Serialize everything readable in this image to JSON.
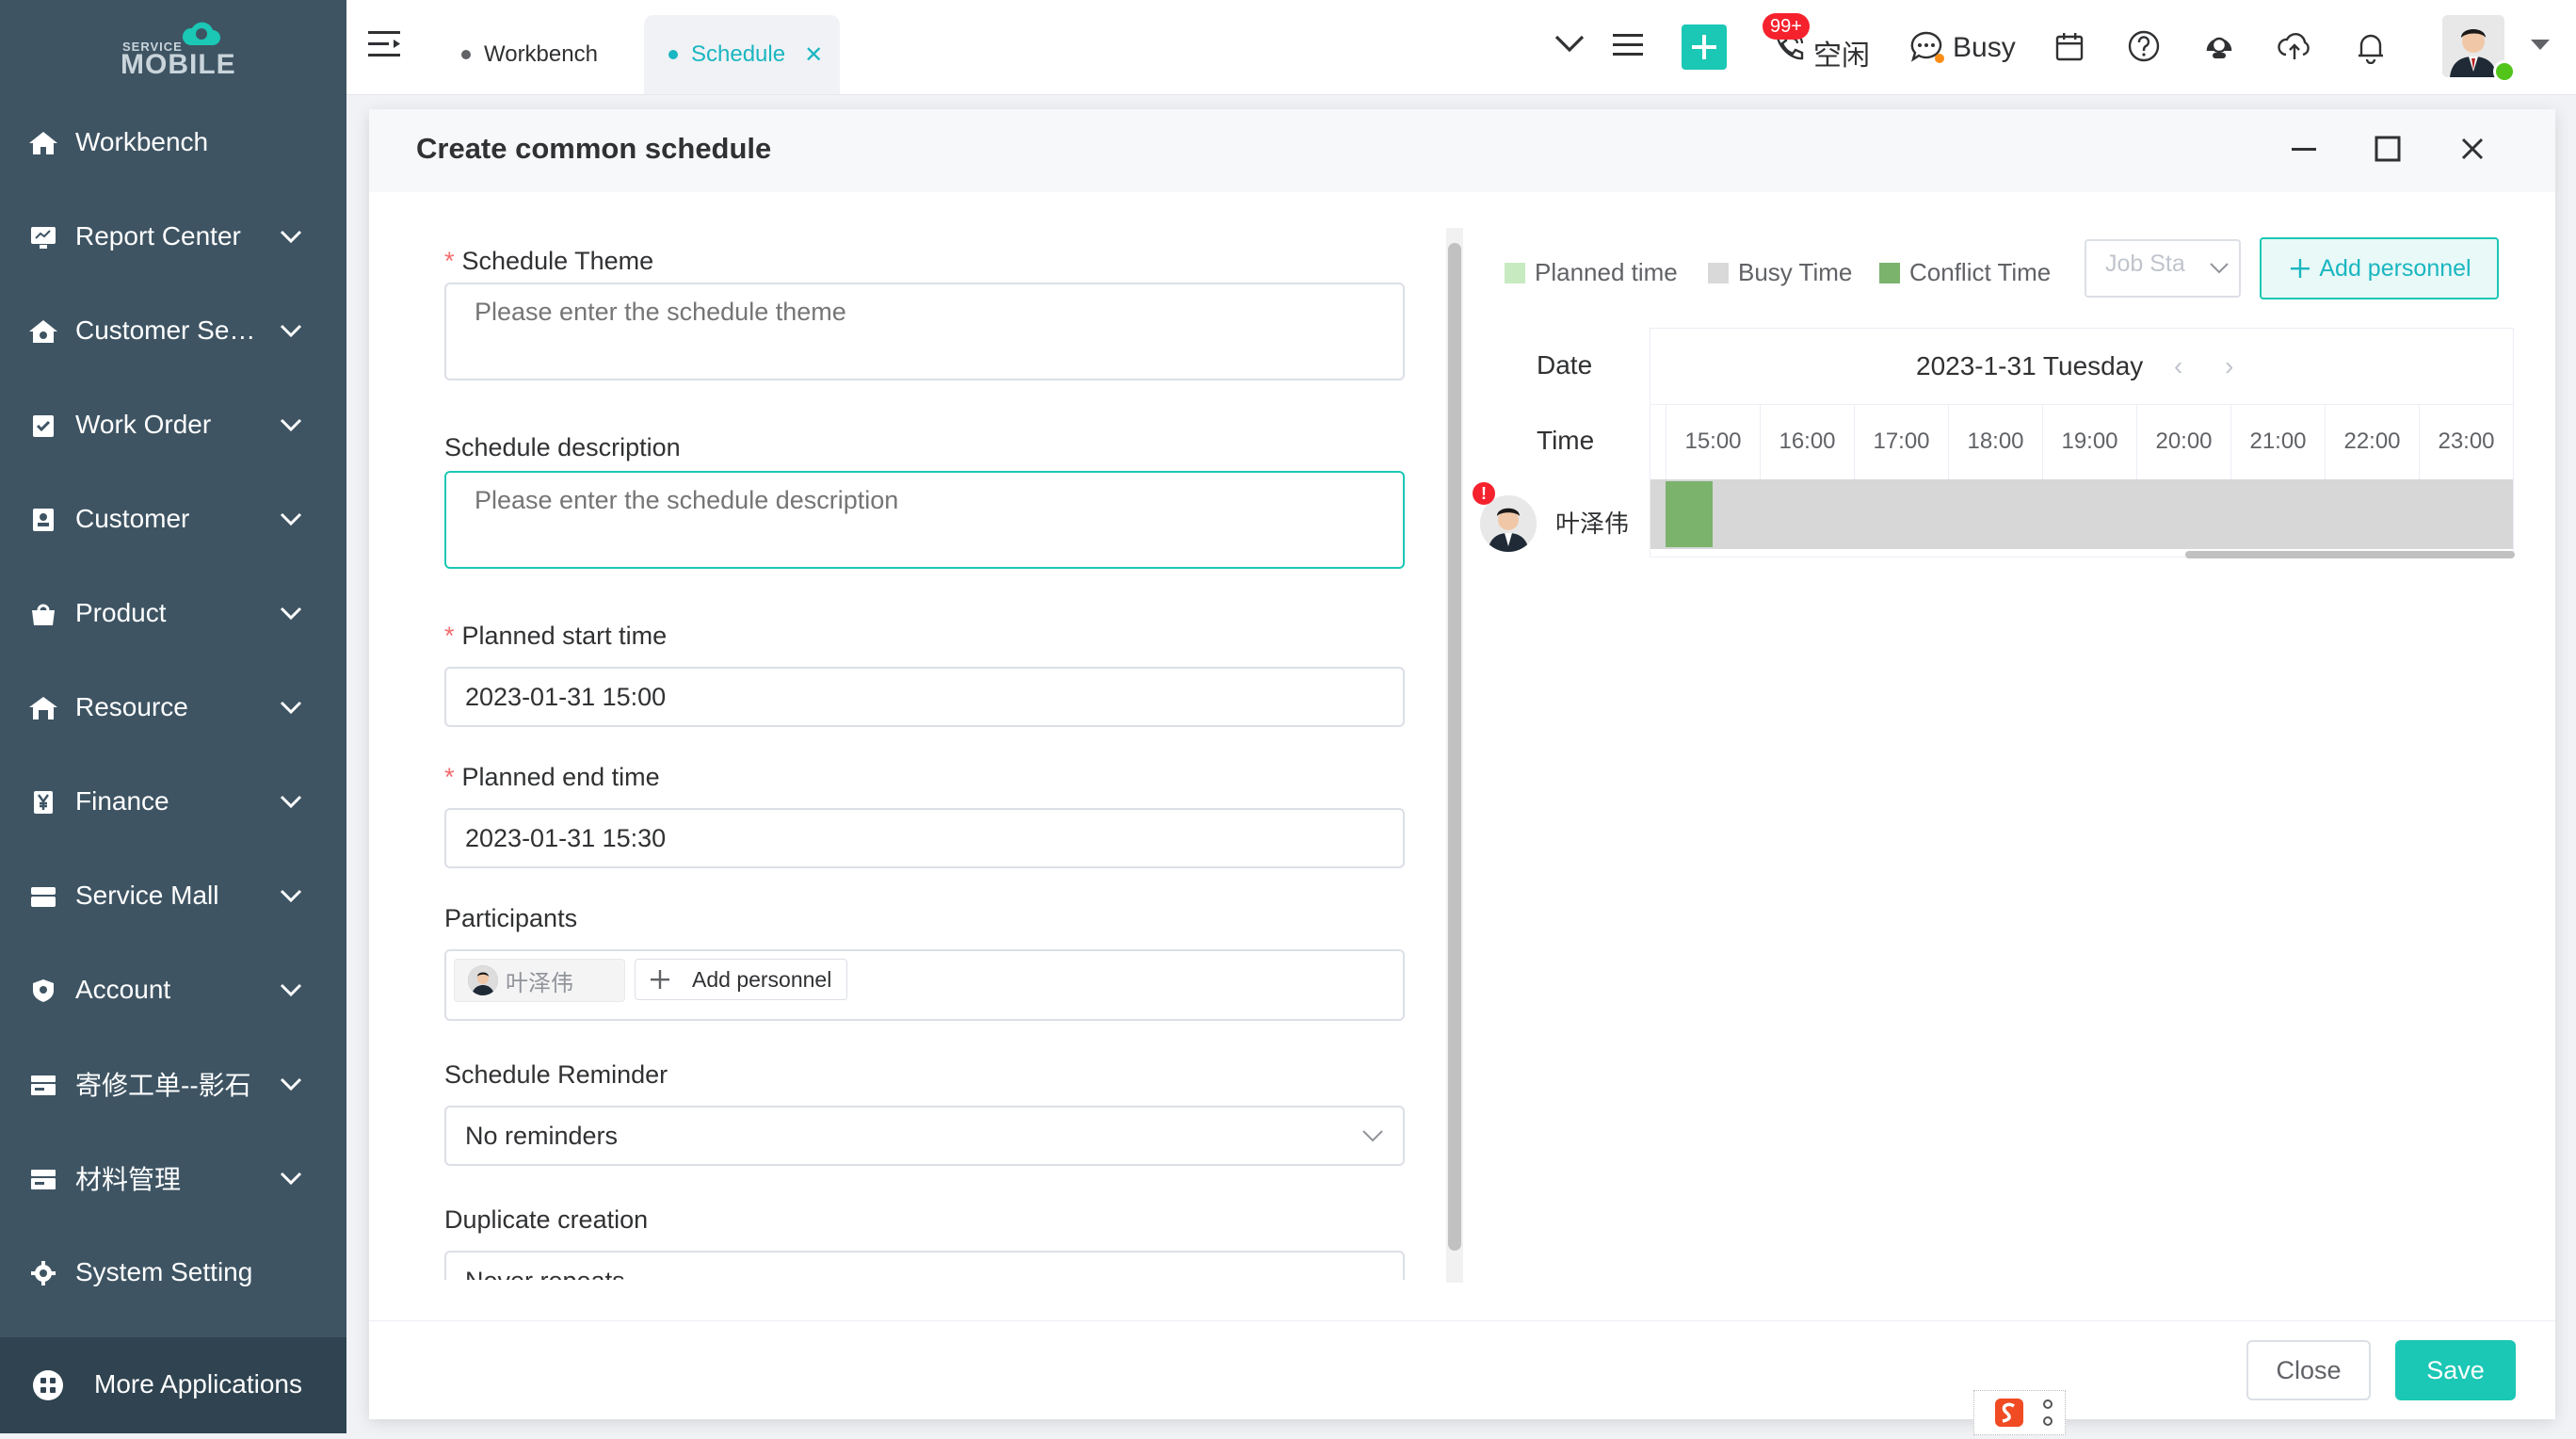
{
  "brand": {
    "line1": "SERVICE",
    "line2": "MOBILE"
  },
  "sidebar": {
    "items": [
      {
        "label": "Workbench"
      },
      {
        "label": "Report Center"
      },
      {
        "label": "Customer Se…"
      },
      {
        "label": "Work Order"
      },
      {
        "label": "Customer"
      },
      {
        "label": "Product"
      },
      {
        "label": "Resource"
      },
      {
        "label": "Finance"
      },
      {
        "label": "Service Mall"
      },
      {
        "label": "Account"
      },
      {
        "label": "寄修工单--影石"
      },
      {
        "label": "材料管理"
      },
      {
        "label": "System Setting"
      }
    ],
    "more": "More Applications"
  },
  "topbar": {
    "tabs": [
      {
        "label": "Workbench"
      },
      {
        "label": "Schedule"
      }
    ],
    "status_idle": "空闲",
    "status_busy": "Busy",
    "notification_count": "99+"
  },
  "dialog": {
    "title": "Create common schedule",
    "form": {
      "theme_label": "Schedule Theme",
      "theme_placeholder": "Please enter the schedule theme",
      "desc_label": "Schedule description",
      "desc_placeholder": "Please enter the schedule description",
      "start_label": "Planned start time",
      "start_value": "2023-01-31 15:00",
      "end_label": "Planned end time",
      "end_value": "2023-01-31 15:30",
      "participants_label": "Participants",
      "participant_name": "叶泽伟",
      "add_personnel_small": "Add personnel",
      "reminder_label": "Schedule Reminder",
      "reminder_value": "No reminders",
      "duplicate_label": "Duplicate creation",
      "duplicate_value": "Never repeats"
    },
    "schedule": {
      "legend": {
        "planned": "Planned time",
        "busy": "Busy Time",
        "conflict": "Conflict Time"
      },
      "legend_colors": {
        "planned": "#c8eac0",
        "busy": "#d9d9d9",
        "conflict": "#7bb36d"
      },
      "job_status_placeholder": "Job Sta",
      "add_personnel": "Add personnel",
      "date_label": "Date",
      "time_label": "Time",
      "date_value": "2023-1-31 Tuesday",
      "hours": [
        "15:00",
        "16:00",
        "17:00",
        "18:00",
        "19:00",
        "20:00",
        "21:00",
        "22:00",
        "23:00"
      ],
      "person": {
        "name": "叶泽伟",
        "alert": "!"
      }
    },
    "footer": {
      "close": "Close",
      "save": "Save"
    }
  },
  "colors": {
    "accent": "#1bc7b5",
    "sidebar": "#3e5463",
    "danger": "#f5222d"
  }
}
